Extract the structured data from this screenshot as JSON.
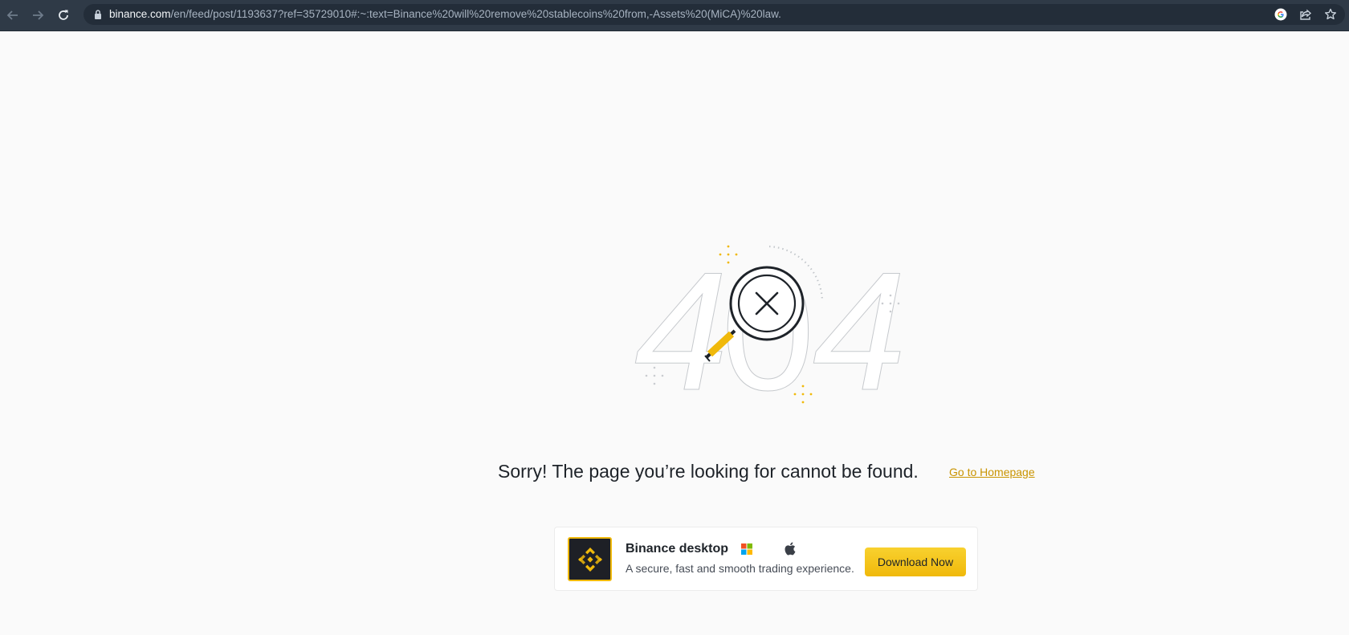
{
  "browser": {
    "url_host": "binance.com",
    "url_path": "/en/feed/post/1193637?ref=35729010#:~:text=Binance%20will%20remove%20stablecoins%20from,-Assets%20(MiCA)%20law.",
    "icons": [
      "back-arrow-icon",
      "forward-arrow-icon",
      "reload-icon",
      "lock-icon",
      "google-icon",
      "share-icon",
      "star-icon"
    ]
  },
  "error": {
    "code_left": "4",
    "code_middle": "0",
    "code_right": "4",
    "message": "Sorry! The page you’re looking for cannot be found.",
    "home_link": "Go to Homepage"
  },
  "promo": {
    "app_name": "Binance desktop",
    "description": "A secure, fast and smooth trading experience.",
    "download_label": "Download Now",
    "icons": [
      "binance-logo-icon",
      "windows-icon",
      "apple-icon"
    ]
  },
  "colors": {
    "accent": "#f0b90b",
    "link": "#c99400",
    "chrome_bg": "#2f3a47",
    "page_bg": "#fafafa",
    "text": "#1e2329"
  }
}
